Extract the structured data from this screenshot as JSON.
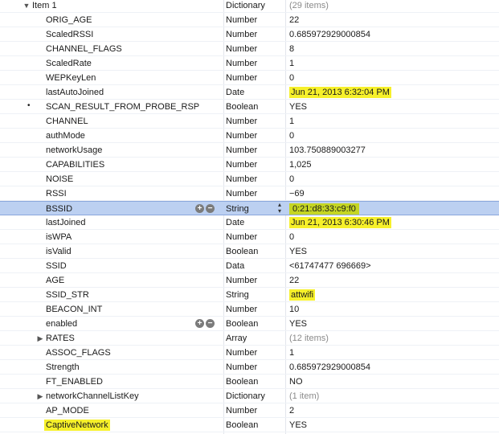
{
  "rows": [
    {
      "key": "Item 1",
      "type": "Dictionary",
      "value": "(29 items)"
    },
    {
      "key": "ORIG_AGE",
      "type": "Number",
      "value": "22"
    },
    {
      "key": "ScaledRSSI",
      "type": "Number",
      "value": "0.685972929000854"
    },
    {
      "key": "CHANNEL_FLAGS",
      "type": "Number",
      "value": "8"
    },
    {
      "key": "ScaledRate",
      "type": "Number",
      "value": "1"
    },
    {
      "key": "WEPKeyLen",
      "type": "Number",
      "value": "0"
    },
    {
      "key": "lastAutoJoined",
      "type": "Date",
      "value": "Jun 21, 2013 6:32:04 PM"
    },
    {
      "key": "SCAN_RESULT_FROM_PROBE_RSP",
      "type": "Boolean",
      "value": "YES"
    },
    {
      "key": "CHANNEL",
      "type": "Number",
      "value": "1"
    },
    {
      "key": "authMode",
      "type": "Number",
      "value": "0"
    },
    {
      "key": "networkUsage",
      "type": "Number",
      "value": "103.750889003277"
    },
    {
      "key": "CAPABILITIES",
      "type": "Number",
      "value": "1,025"
    },
    {
      "key": "NOISE",
      "type": "Number",
      "value": "0"
    },
    {
      "key": "RSSI",
      "type": "Number",
      "value": "−69"
    },
    {
      "key": "BSSID",
      "type": "String",
      "value": "0:21:d8:33:c9:f0"
    },
    {
      "key": "lastJoined",
      "type": "Date",
      "value": "Jun 21, 2013 6:30:46 PM"
    },
    {
      "key": "isWPA",
      "type": "Number",
      "value": "0"
    },
    {
      "key": "isValid",
      "type": "Boolean",
      "value": "YES"
    },
    {
      "key": "SSID",
      "type": "Data",
      "value": "<61747477 696669>"
    },
    {
      "key": "AGE",
      "type": "Number",
      "value": "22"
    },
    {
      "key": "SSID_STR",
      "type": "String",
      "value": "attwifi"
    },
    {
      "key": "BEACON_INT",
      "type": "Number",
      "value": "10"
    },
    {
      "key": "enabled",
      "type": "Boolean",
      "value": "YES"
    },
    {
      "key": "RATES",
      "type": "Array",
      "value": "(12 items)"
    },
    {
      "key": "ASSOC_FLAGS",
      "type": "Number",
      "value": "1"
    },
    {
      "key": "Strength",
      "type": "Number",
      "value": "0.685972929000854"
    },
    {
      "key": "FT_ENABLED",
      "type": "Boolean",
      "value": "NO"
    },
    {
      "key": "networkChannelListKey",
      "type": "Dictionary",
      "value": "(1 item)"
    },
    {
      "key": "AP_MODE",
      "type": "Number",
      "value": "2"
    },
    {
      "key": "CaptiveNetwork",
      "type": "Boolean",
      "value": "YES"
    }
  ],
  "controls": {
    "plus": "+",
    "minus": "−",
    "expanded_icon": "▼",
    "collapsed_icon": "▶",
    "bullet": "•",
    "stepper": "▴▾"
  },
  "colors": {
    "highlight_yellow": "#f6f02a",
    "highlight_green": "#c5d624",
    "selection": "#bcd0f1"
  }
}
